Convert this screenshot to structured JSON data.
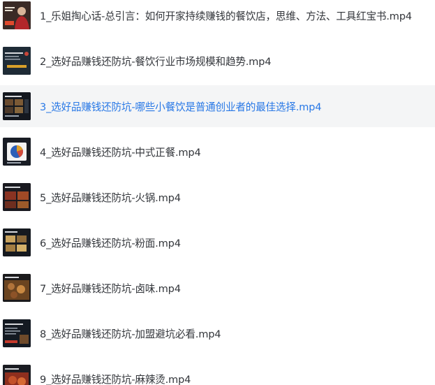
{
  "file_list": {
    "selected_index": 2,
    "items": [
      {
        "name": "1_乐姐掏心话-总引言：如何开家持续赚钱的餐饮店，思维、方法、工具红宝书.mp4",
        "thumbnail_icon": "video-thumbnail-presenter"
      },
      {
        "name": "2_选好品赚钱还防坑-餐饮行业市场规模和趋势.mp4",
        "thumbnail_icon": "video-thumbnail-slide"
      },
      {
        "name": "3_选好品赚钱还防坑-哪些小餐饮是普通创业者的最佳选择.mp4",
        "thumbnail_icon": "video-thumbnail-slide"
      },
      {
        "name": "4_选好品赚钱还防坑-中式正餐.mp4",
        "thumbnail_icon": "video-thumbnail-pie-chart"
      },
      {
        "name": "5_选好品赚钱还防坑-火锅.mp4",
        "thumbnail_icon": "video-thumbnail-food"
      },
      {
        "name": "6_选好品赚钱还防坑-粉面.mp4",
        "thumbnail_icon": "video-thumbnail-food"
      },
      {
        "name": "7_选好品赚钱还防坑-卤味.mp4",
        "thumbnail_icon": "video-thumbnail-food"
      },
      {
        "name": "8_选好品赚钱还防坑-加盟避坑必看.mp4",
        "thumbnail_icon": "video-thumbnail-slide"
      },
      {
        "name": "9_选好品赚钱还防坑-麻辣烫.mp4",
        "thumbnail_icon": "video-thumbnail-food"
      }
    ],
    "colors": {
      "text": "#33363b",
      "selected_text": "#2878e6",
      "selected_background": "#f4f5f6"
    }
  }
}
